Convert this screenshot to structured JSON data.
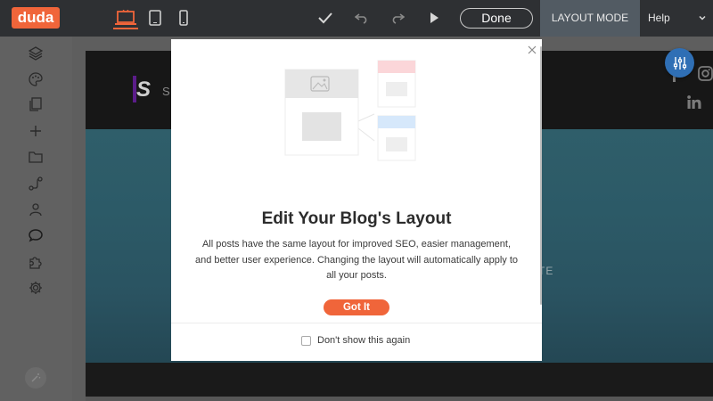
{
  "topbar": {
    "logo_text": "duda",
    "done_label": "Done",
    "layout_mode_label": "LAYOUT MODE",
    "help_label": "Help",
    "accent_color": "#f0653a",
    "icons": [
      "desktop-icon",
      "tablet-icon",
      "mobile-icon",
      "checkmark-icon",
      "undo-icon",
      "redo-icon",
      "play-icon",
      "chevron-down-icon"
    ]
  },
  "sidebar": {
    "items": [
      {
        "icon": "layers-icon"
      },
      {
        "icon": "palette-icon"
      },
      {
        "icon": "pages-icon"
      },
      {
        "icon": "plus-icon"
      },
      {
        "icon": "folder-icon"
      },
      {
        "icon": "flow-icon"
      },
      {
        "icon": "user-icon"
      },
      {
        "icon": "comment-icon"
      },
      {
        "icon": "puzzle-icon"
      },
      {
        "icon": "gear-icon"
      }
    ],
    "bottom_icon": "magic-wand-icon"
  },
  "site": {
    "brand_letter": "S",
    "brand_partial": "SC",
    "hero_partial_text": "TE",
    "social": [
      "facebook-icon",
      "instagram-icon",
      "linkedin-icon"
    ]
  },
  "modal": {
    "title": "Edit Your Blog's Layout",
    "description": "All posts have the same layout for improved SEO, easier management, and better user experience. Changing the layout will automatically apply to all your posts.",
    "primary_button": "Got It",
    "checkbox_label": "Don't show this again",
    "checkbox_checked": false
  }
}
